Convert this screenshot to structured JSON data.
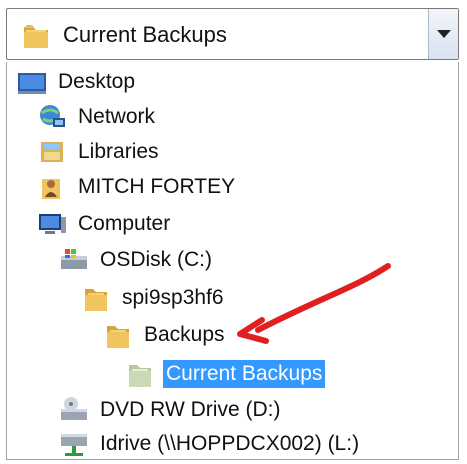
{
  "combo": {
    "value": "Current Backups",
    "icon": "folder-icon"
  },
  "tree": {
    "items": [
      {
        "label": "Desktop",
        "icon": "desktop-icon"
      },
      {
        "label": "Network",
        "icon": "network-icon"
      },
      {
        "label": "Libraries",
        "icon": "libraries-icon"
      },
      {
        "label": "MITCH FORTEY",
        "icon": "user-folder-icon"
      },
      {
        "label": "Computer",
        "icon": "computer-icon"
      },
      {
        "label": "OSDisk (C:)",
        "icon": "hard-disk-icon"
      },
      {
        "label": "spi9sp3hf6",
        "icon": "folder-icon"
      },
      {
        "label": "Backups",
        "icon": "folder-icon"
      },
      {
        "label": "Current Backups",
        "icon": "folder-icon",
        "selected": true
      },
      {
        "label": "DVD RW Drive (D:)",
        "icon": "dvd-drive-icon"
      },
      {
        "label": "Idrive (\\\\HOPPDCX002) (L:)",
        "icon": "network-drive-icon"
      }
    ]
  },
  "colors": {
    "selection": "#3399ff",
    "annotation_arrow": "#e02020"
  }
}
